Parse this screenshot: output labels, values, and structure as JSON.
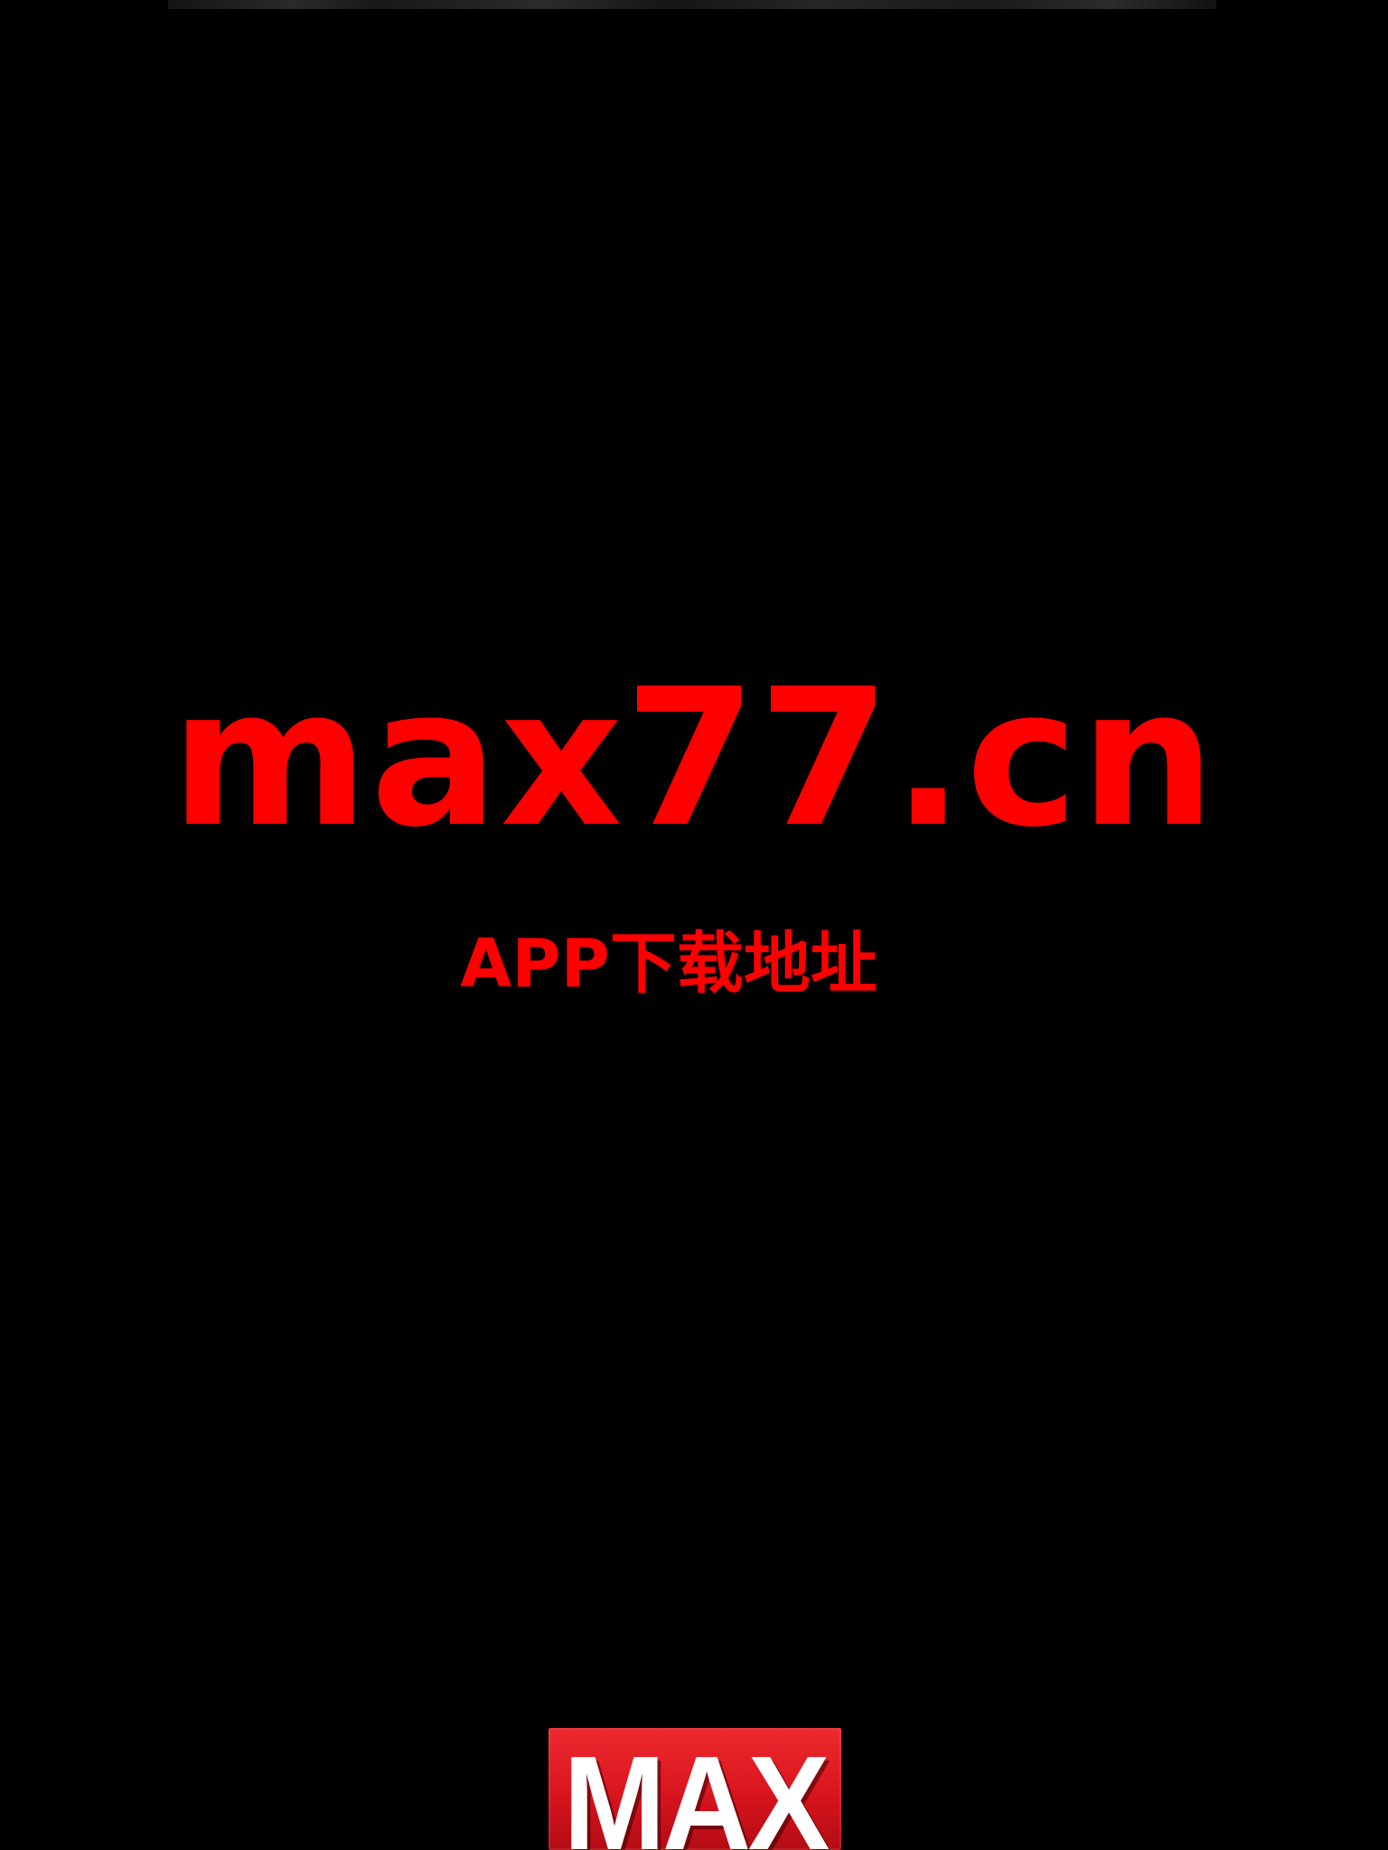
{
  "domain_text": "max77.cn",
  "subtitle": "APP下载地址",
  "logo": {
    "text": "MAX"
  },
  "colors": {
    "background": "#000000",
    "accent_red": "#ff0000",
    "logo_bg": "#d8141e"
  }
}
